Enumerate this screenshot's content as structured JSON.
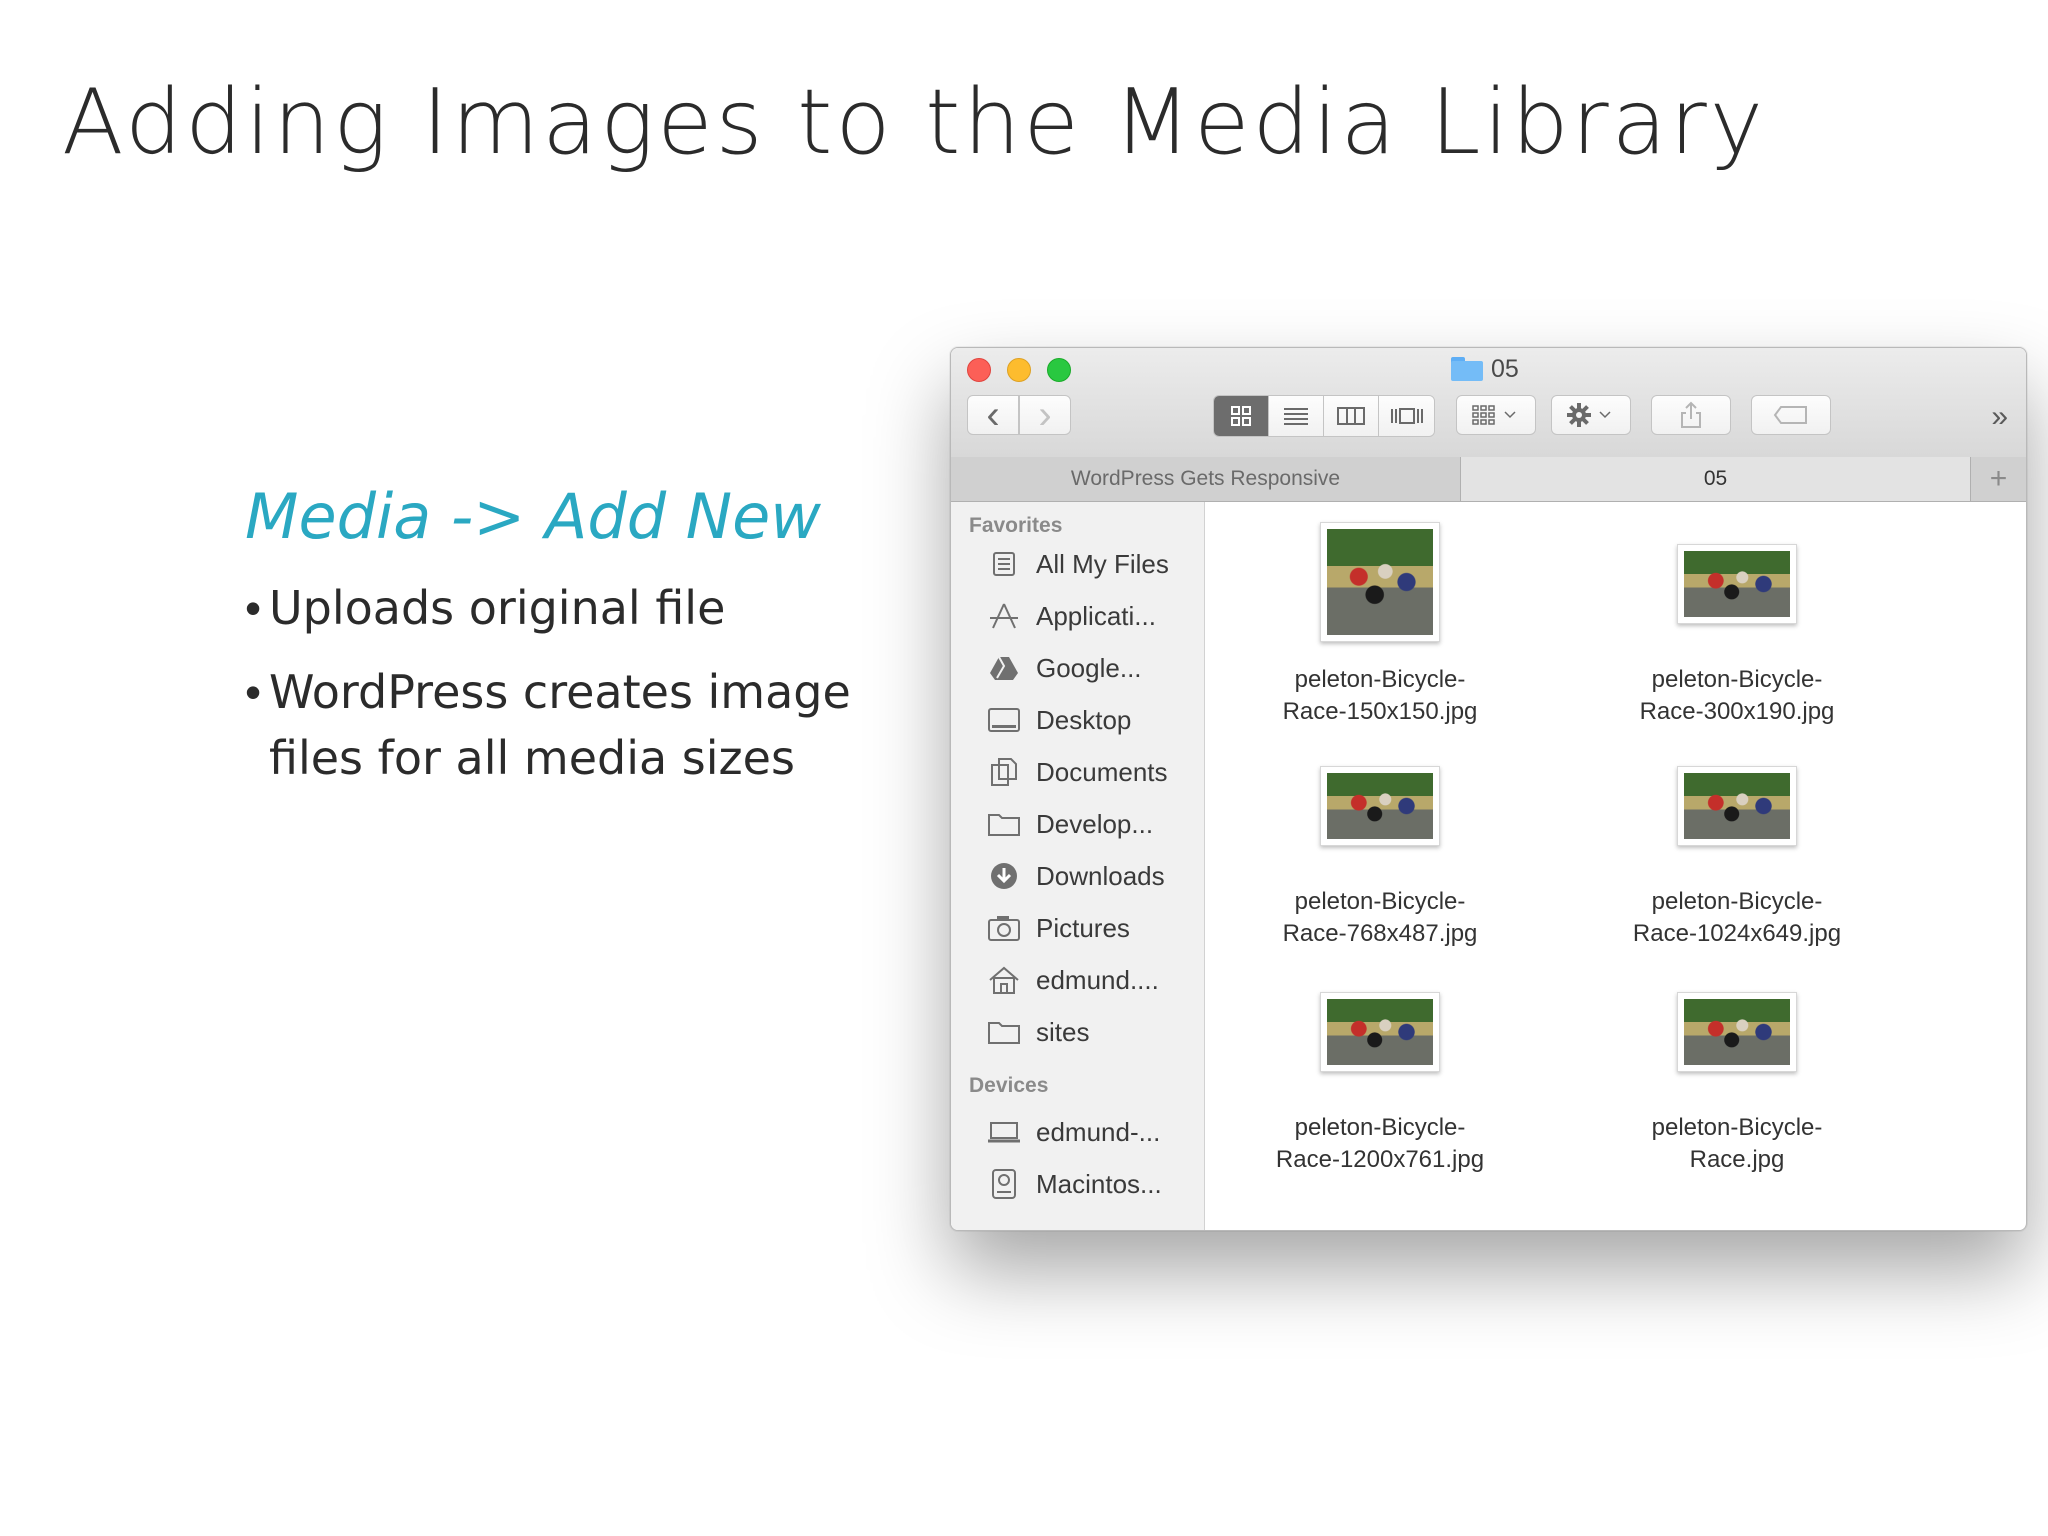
{
  "slide": {
    "title": "Adding Images to the Media Library",
    "subhead": "Media -> Add New",
    "bullets": [
      "Uploads original file",
      "WordPress creates image files for all media sizes"
    ]
  },
  "finder": {
    "window_title": "05",
    "tabs": [
      "WordPress Gets Responsive",
      "05"
    ],
    "tab_add": "+",
    "toolbar": {
      "back": "‹",
      "forward": "›",
      "overflow": "»"
    },
    "sidebar": {
      "favorites_heading": "Favorites",
      "favorites": [
        {
          "label": "All My Files",
          "icon": "all-files-icon"
        },
        {
          "label": "Applicati...",
          "icon": "applications-icon"
        },
        {
          "label": "Google...",
          "icon": "google-drive-icon"
        },
        {
          "label": "Desktop",
          "icon": "desktop-icon"
        },
        {
          "label": "Documents",
          "icon": "documents-icon"
        },
        {
          "label": "Develop...",
          "icon": "folder-icon"
        },
        {
          "label": "Downloads",
          "icon": "downloads-icon"
        },
        {
          "label": "Pictures",
          "icon": "pictures-icon"
        },
        {
          "label": "edmund....",
          "icon": "home-icon"
        },
        {
          "label": "sites",
          "icon": "folder-icon"
        }
      ],
      "devices_heading": "Devices",
      "devices": [
        {
          "label": "edmund-...",
          "icon": "laptop-icon"
        },
        {
          "label": "Macintos...",
          "icon": "disk-icon"
        }
      ]
    },
    "files": [
      {
        "line1": "peleton-Bicycle-",
        "line2": "Race-150x150.jpg",
        "thumb": "square"
      },
      {
        "line1": "peleton-Bicycle-",
        "line2": "Race-300x190.jpg",
        "thumb": "wide"
      },
      {
        "line1": "peleton-Bicycle-",
        "line2": "Race-768x487.jpg",
        "thumb": "wide"
      },
      {
        "line1": "peleton-Bicycle-",
        "line2": "Race-1024x649.jpg",
        "thumb": "wide"
      },
      {
        "line1": "peleton-Bicycle-",
        "line2": "Race-1200x761.jpg",
        "thumb": "wide"
      },
      {
        "line1": "peleton-Bicycle-",
        "line2": "Race.jpg",
        "thumb": "wide"
      }
    ]
  }
}
